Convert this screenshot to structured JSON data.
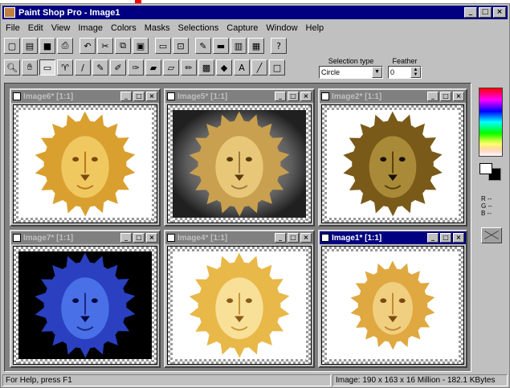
{
  "window": {
    "title": "Paint Shop Pro - Image1",
    "buttons": [
      "_",
      "□",
      "×"
    ]
  },
  "menu": [
    "File",
    "Edit",
    "View",
    "Image",
    "Colors",
    "Masks",
    "Selections",
    "Capture",
    "Window",
    "Help"
  ],
  "toolbar1": [
    {
      "icon": "new-icon",
      "glyph": "▢"
    },
    {
      "icon": "open-icon",
      "glyph": "▤"
    },
    {
      "icon": "save-icon",
      "glyph": "■"
    },
    {
      "icon": "print-icon",
      "glyph": "⎙"
    },
    {
      "icon": "undo-icon",
      "glyph": "↶"
    },
    {
      "icon": "cut-icon",
      "glyph": "✂"
    },
    {
      "icon": "copy-icon",
      "glyph": "⧉"
    },
    {
      "icon": "paste-icon",
      "glyph": "▣"
    },
    {
      "icon": "screen-capture-icon",
      "glyph": "▭"
    },
    {
      "icon": "zoom-window-icon",
      "glyph": "⊡"
    },
    {
      "icon": "brush-icon",
      "glyph": "✎"
    },
    {
      "icon": "tool-palette-icon",
      "glyph": "▬"
    },
    {
      "icon": "color-palette-icon",
      "glyph": "▥"
    },
    {
      "icon": "image-icon",
      "glyph": "▦"
    },
    {
      "icon": "help-icon",
      "glyph": "?"
    }
  ],
  "toolbar2": [
    {
      "icon": "zoom-icon",
      "glyph": "🔍︎"
    },
    {
      "icon": "hand-icon",
      "glyph": "✋︎"
    },
    {
      "icon": "selection-icon",
      "glyph": "▭",
      "active": true
    },
    {
      "icon": "lasso-icon",
      "glyph": "♈︎"
    },
    {
      "icon": "eyedropper-icon",
      "glyph": "/"
    },
    {
      "icon": "paintbrush-icon",
      "glyph": "✎"
    },
    {
      "icon": "clone-icon",
      "glyph": "✐"
    },
    {
      "icon": "color-replacer-icon",
      "glyph": "✑"
    },
    {
      "icon": "retouch-icon",
      "glyph": "▰"
    },
    {
      "icon": "eraser-icon",
      "glyph": "▱"
    },
    {
      "icon": "spray-icon",
      "glyph": "✏"
    },
    {
      "icon": "flood-fill-icon",
      "glyph": "▩"
    },
    {
      "icon": "fill-bucket-icon",
      "glyph": "◆"
    },
    {
      "icon": "text-icon",
      "glyph": "A"
    },
    {
      "icon": "line-icon",
      "glyph": "╱"
    },
    {
      "icon": "shape-icon",
      "glyph": "□"
    }
  ],
  "selection_type": {
    "label": "Selection type",
    "value": "Circle"
  },
  "feather": {
    "label": "Feather",
    "value": "0"
  },
  "documents": [
    {
      "title": "Image6* [1:1]",
      "style": "normal",
      "active": false
    },
    {
      "title": "Image5* [1:1]",
      "style": "glow",
      "active": false
    },
    {
      "title": "Image2* [1:1]",
      "style": "emboss",
      "active": false
    },
    {
      "title": "Image7* [1:1]",
      "style": "blue",
      "active": false
    },
    {
      "title": "Image4* [1:1]",
      "style": "smooth",
      "active": false
    },
    {
      "title": "Image1* [1:1]",
      "style": "small",
      "active": true
    }
  ],
  "palette": {
    "r": "R --",
    "g": "G --",
    "b": "B --"
  },
  "status": {
    "help": "For Help, press F1",
    "image_info": "Image:  190 x 163 x 16 Million - 182.1 KBytes"
  }
}
